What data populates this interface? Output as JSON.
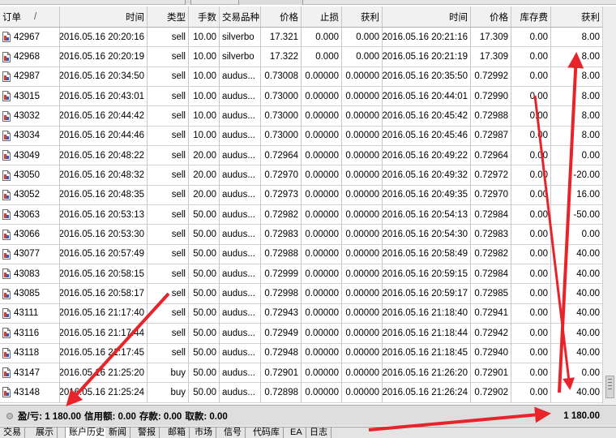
{
  "columns": {
    "order": "订单",
    "sort_mark": "/",
    "open_time": "时间",
    "type": "类型",
    "lots": "手数",
    "symbol": "交易品种",
    "open_price": "价格",
    "sl": "止损",
    "tp": "获利",
    "close_time": "时间",
    "close_price": "价格",
    "swap": "库存费",
    "profit": "获利"
  },
  "rows": [
    {
      "order": "42967",
      "open_time": "2016.05.16 20:20:16",
      "type": "sell",
      "lots": "10.00",
      "symbol": "silverbo",
      "open_price": "17.321",
      "sl": "0.000",
      "tp": "0.000",
      "close_time": "2016.05.16 20:21:16",
      "close_price": "17.309",
      "swap": "0.00",
      "profit": "8.00"
    },
    {
      "order": "42968",
      "open_time": "2016.05.16 20:20:19",
      "type": "sell",
      "lots": "10.00",
      "symbol": "silverbo",
      "open_price": "17.322",
      "sl": "0.000",
      "tp": "0.000",
      "close_time": "2016.05.16 20:21:19",
      "close_price": "17.309",
      "swap": "0.00",
      "profit": "8.00"
    },
    {
      "order": "42987",
      "open_time": "2016.05.16 20:34:50",
      "type": "sell",
      "lots": "10.00",
      "symbol": "audus...",
      "open_price": "0.73008",
      "sl": "0.00000",
      "tp": "0.00000",
      "close_time": "2016.05.16 20:35:50",
      "close_price": "0.72992",
      "swap": "0.00",
      "profit": "8.00"
    },
    {
      "order": "43015",
      "open_time": "2016.05.16 20:43:01",
      "type": "sell",
      "lots": "10.00",
      "symbol": "audus...",
      "open_price": "0.73000",
      "sl": "0.00000",
      "tp": "0.00000",
      "close_time": "2016.05.16 20:44:01",
      "close_price": "0.72990",
      "swap": "0.00",
      "profit": "8.00"
    },
    {
      "order": "43032",
      "open_time": "2016.05.16 20:44:42",
      "type": "sell",
      "lots": "10.00",
      "symbol": "audus...",
      "open_price": "0.73000",
      "sl": "0.00000",
      "tp": "0.00000",
      "close_time": "2016.05.16 20:45:42",
      "close_price": "0.72988",
      "swap": "0.00",
      "profit": "8.00"
    },
    {
      "order": "43034",
      "open_time": "2016.05.16 20:44:46",
      "type": "sell",
      "lots": "10.00",
      "symbol": "audus...",
      "open_price": "0.73000",
      "sl": "0.00000",
      "tp": "0.00000",
      "close_time": "2016.05.16 20:45:46",
      "close_price": "0.72987",
      "swap": "0.00",
      "profit": "8.00"
    },
    {
      "order": "43049",
      "open_time": "2016.05.16 20:48:22",
      "type": "sell",
      "lots": "20.00",
      "symbol": "audus...",
      "open_price": "0.72964",
      "sl": "0.00000",
      "tp": "0.00000",
      "close_time": "2016.05.16 20:49:22",
      "close_price": "0.72964",
      "swap": "0.00",
      "profit": "0.00"
    },
    {
      "order": "43050",
      "open_time": "2016.05.16 20:48:32",
      "type": "sell",
      "lots": "20.00",
      "symbol": "audus...",
      "open_price": "0.72970",
      "sl": "0.00000",
      "tp": "0.00000",
      "close_time": "2016.05.16 20:49:32",
      "close_price": "0.72972",
      "swap": "0.00",
      "profit": "-20.00"
    },
    {
      "order": "43052",
      "open_time": "2016.05.16 20:48:35",
      "type": "sell",
      "lots": "20.00",
      "symbol": "audus...",
      "open_price": "0.72973",
      "sl": "0.00000",
      "tp": "0.00000",
      "close_time": "2016.05.16 20:49:35",
      "close_price": "0.72970",
      "swap": "0.00",
      "profit": "16.00"
    },
    {
      "order": "43063",
      "open_time": "2016.05.16 20:53:13",
      "type": "sell",
      "lots": "50.00",
      "symbol": "audus...",
      "open_price": "0.72982",
      "sl": "0.00000",
      "tp": "0.00000",
      "close_time": "2016.05.16 20:54:13",
      "close_price": "0.72984",
      "swap": "0.00",
      "profit": "-50.00"
    },
    {
      "order": "43066",
      "open_time": "2016.05.16 20:53:30",
      "type": "sell",
      "lots": "50.00",
      "symbol": "audus...",
      "open_price": "0.72983",
      "sl": "0.00000",
      "tp": "0.00000",
      "close_time": "2016.05.16 20:54:30",
      "close_price": "0.72983",
      "swap": "0.00",
      "profit": "0.00"
    },
    {
      "order": "43077",
      "open_time": "2016.05.16 20:57:49",
      "type": "sell",
      "lots": "50.00",
      "symbol": "audus...",
      "open_price": "0.72988",
      "sl": "0.00000",
      "tp": "0.00000",
      "close_time": "2016.05.16 20:58:49",
      "close_price": "0.72982",
      "swap": "0.00",
      "profit": "40.00"
    },
    {
      "order": "43083",
      "open_time": "2016.05.16 20:58:15",
      "type": "sell",
      "lots": "50.00",
      "symbol": "audus...",
      "open_price": "0.72999",
      "sl": "0.00000",
      "tp": "0.00000",
      "close_time": "2016.05.16 20:59:15",
      "close_price": "0.72984",
      "swap": "0.00",
      "profit": "40.00"
    },
    {
      "order": "43085",
      "open_time": "2016.05.16 20:58:17",
      "type": "sell",
      "lots": "50.00",
      "symbol": "audus...",
      "open_price": "0.72998",
      "sl": "0.00000",
      "tp": "0.00000",
      "close_time": "2016.05.16 20:59:17",
      "close_price": "0.72985",
      "swap": "0.00",
      "profit": "40.00"
    },
    {
      "order": "43111",
      "open_time": "2016.05.16 21:17:40",
      "type": "sell",
      "lots": "50.00",
      "symbol": "audus...",
      "open_price": "0.72943",
      "sl": "0.00000",
      "tp": "0.00000",
      "close_time": "2016.05.16 21:18:40",
      "close_price": "0.72941",
      "swap": "0.00",
      "profit": "40.00"
    },
    {
      "order": "43116",
      "open_time": "2016.05.16 21:17:44",
      "type": "sell",
      "lots": "50.00",
      "symbol": "audus...",
      "open_price": "0.72949",
      "sl": "0.00000",
      "tp": "0.00000",
      "close_time": "2016.05.16 21:18:44",
      "close_price": "0.72942",
      "swap": "0.00",
      "profit": "40.00"
    },
    {
      "order": "43118",
      "open_time": "2016.05.16 21:17:45",
      "type": "sell",
      "lots": "50.00",
      "symbol": "audus...",
      "open_price": "0.72948",
      "sl": "0.00000",
      "tp": "0.00000",
      "close_time": "2016.05.16 21:18:45",
      "close_price": "0.72940",
      "swap": "0.00",
      "profit": "40.00"
    },
    {
      "order": "43147",
      "open_time": "2016.05.16 21:25:20",
      "type": "buy",
      "lots": "50.00",
      "symbol": "audus...",
      "open_price": "0.72901",
      "sl": "0.00000",
      "tp": "0.00000",
      "close_time": "2016.05.16 21:26:20",
      "close_price": "0.72901",
      "swap": "0.00",
      "profit": "0.00"
    },
    {
      "order": "43148",
      "open_time": "2016.05.16 21:25:24",
      "type": "buy",
      "lots": "50.00",
      "symbol": "audus...",
      "open_price": "0.72898",
      "sl": "0.00000",
      "tp": "0.00000",
      "close_time": "2016.05.16 21:26:24",
      "close_price": "0.72902",
      "swap": "0.00",
      "profit": "40.00"
    }
  ],
  "summary": {
    "pl_label": "盈/亏: 1 180.00",
    "credit_label": "信用额: 0.00",
    "deposit_label": "存款: 0.00",
    "withdraw_label": "取款: 0.00",
    "total": "1 180.00"
  },
  "tabs": [
    "交易",
    "展示",
    "账户历史",
    "新闻",
    "警报",
    "邮箱",
    "市场",
    "信号",
    "代码库",
    "EA",
    "日志"
  ],
  "active_tab_index": 2,
  "colors": {
    "annotation_arrow": "#e8232a",
    "header_bg": "#f1f1f1",
    "summary_bg": "#dedede",
    "grid_line": "#d2d2d2"
  }
}
